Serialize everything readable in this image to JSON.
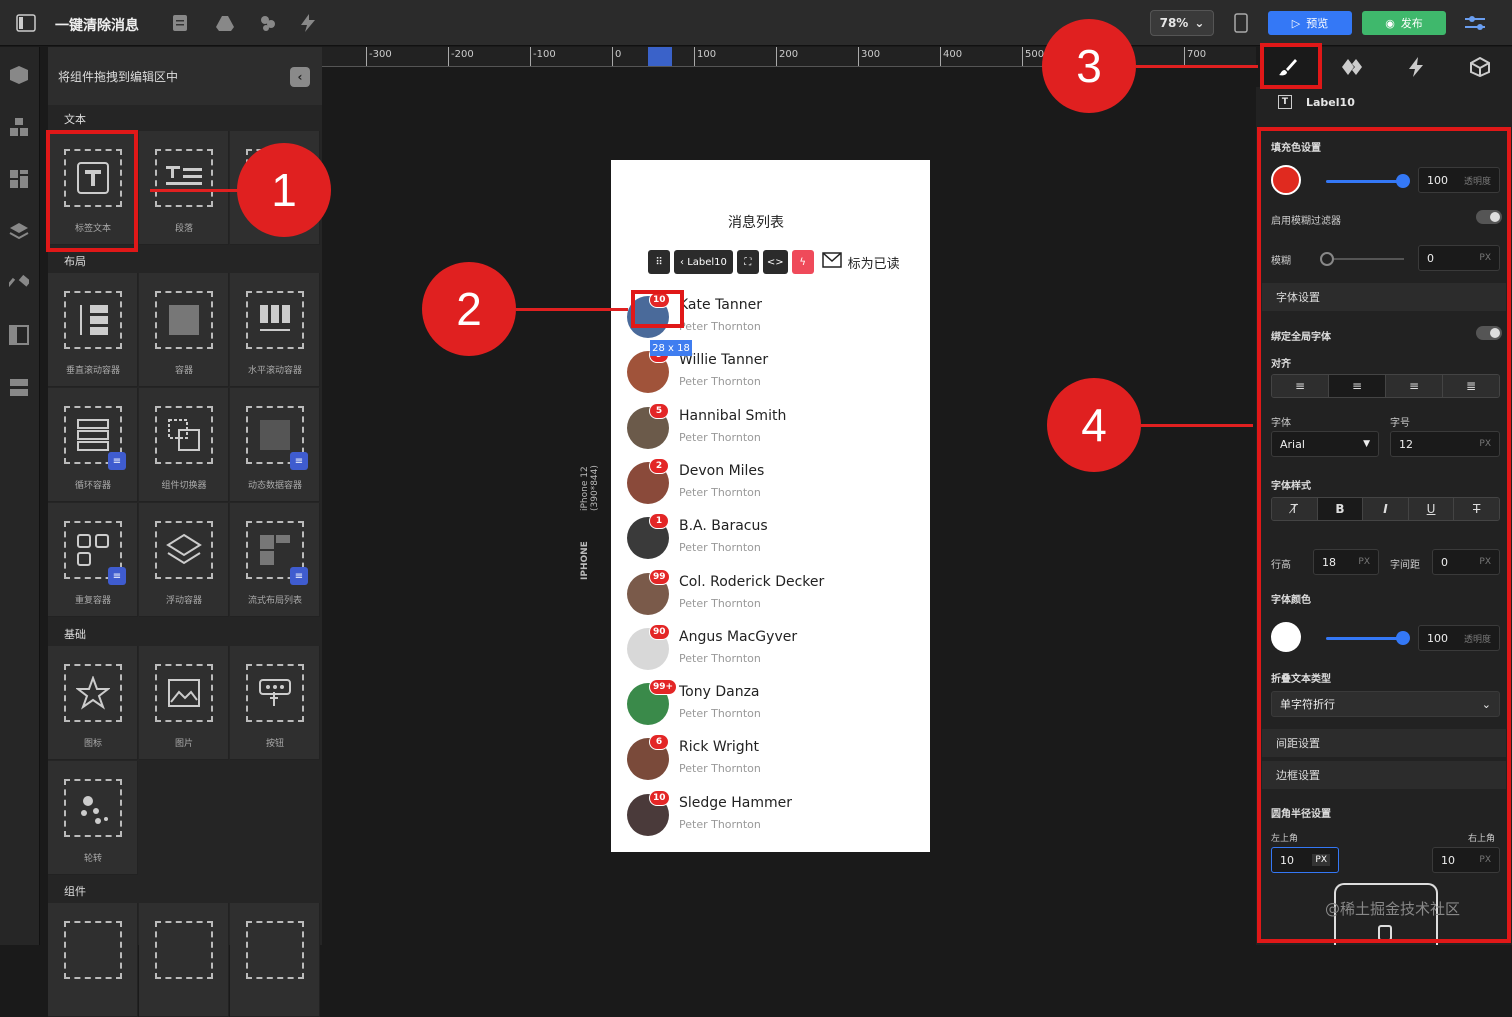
{
  "topbar": {
    "title": "一键清除消息",
    "zoom": "78%",
    "preview": "预览",
    "publish": "发布"
  },
  "left_panel": {
    "header": "将组件拖拽到编辑区中",
    "sections": {
      "text": "文本",
      "layout": "布局",
      "basic": "基础",
      "components": "组件"
    },
    "text_items": [
      "标签文本",
      "段落"
    ],
    "layout_items": [
      "垂直滚动容器",
      "容器",
      "水平滚动容器",
      "循环容器",
      "组件切换器",
      "动态数据容器",
      "重复容器",
      "浮动容器",
      "流式布局列表"
    ],
    "basic_items": [
      "图标",
      "图片",
      "按钮",
      "轮转"
    ]
  },
  "ruler": [
    "-300",
    "-200",
    "-100",
    "0",
    "100",
    "200",
    "300",
    "400",
    "500",
    "700"
  ],
  "device": {
    "label": "iPhone 12 (390*844)",
    "brand": "IPHONE"
  },
  "phone": {
    "title": "消息列表",
    "toolbar_label": "Label10",
    "mark_read": "标为已读",
    "size_tag": "28 x 18",
    "rows": [
      {
        "name": "Kate Tanner",
        "sub": "Peter Thornton",
        "badge": "10",
        "color": "#4a6a9a"
      },
      {
        "name": "Willie Tanner",
        "sub": "Peter Thornton",
        "badge": "9",
        "color": "#a0533a"
      },
      {
        "name": "Hannibal Smith",
        "sub": "Peter Thornton",
        "badge": "5",
        "color": "#6b5a4a"
      },
      {
        "name": "Devon Miles",
        "sub": "Peter Thornton",
        "badge": "2",
        "color": "#8a4a3a"
      },
      {
        "name": "B.A. Baracus",
        "sub": "Peter Thornton",
        "badge": "1",
        "color": "#3a3a3a"
      },
      {
        "name": "Col. Roderick Decker",
        "sub": "Peter Thornton",
        "badge": "99",
        "color": "#7a5a4a"
      },
      {
        "name": "Angus MacGyver",
        "sub": "Peter Thornton",
        "badge": "90",
        "color": "#d8d8d8"
      },
      {
        "name": "Tony Danza",
        "sub": "Peter Thornton",
        "badge": "99+",
        "color": "#3a8a4a"
      },
      {
        "name": "Rick Wright",
        "sub": "Peter Thornton",
        "badge": "6",
        "color": "#7a4a3a"
      },
      {
        "name": "Sledge Hammer",
        "sub": "Peter Thornton",
        "badge": "10",
        "color": "#4a3a3a"
      }
    ]
  },
  "callouts": [
    "1",
    "2",
    "3",
    "4"
  ],
  "right_panel": {
    "component": "Label10",
    "fill_title": "填充色设置",
    "fill_color": "#e02a1f",
    "fill_opacity": "100",
    "opacity_unit": "透明度",
    "blur_filter": "启用模糊过滤器",
    "blur": "模糊",
    "blur_value": "0",
    "px": "PX",
    "font_settings": "字体设置",
    "bind_font": "绑定全局字体",
    "align": "对齐",
    "font": "字体",
    "font_value": "Arial",
    "size": "字号",
    "size_value": "12",
    "font_style": "字体样式",
    "line_height": "行高",
    "line_height_value": "18",
    "letter_spacing": "字间距",
    "letter_spacing_value": "0",
    "font_color": "字体颜色",
    "font_color_opacity": "100",
    "wrap_type": "折叠文本类型",
    "wrap_value": "单字符折行",
    "spacing": "间距设置",
    "border": "边框设置",
    "radius": "圆角半径设置",
    "top_left": "左上角",
    "top_right": "右上角",
    "tl_value": "10",
    "tr_value": "10"
  },
  "watermark": "@稀土掘金技术社区"
}
